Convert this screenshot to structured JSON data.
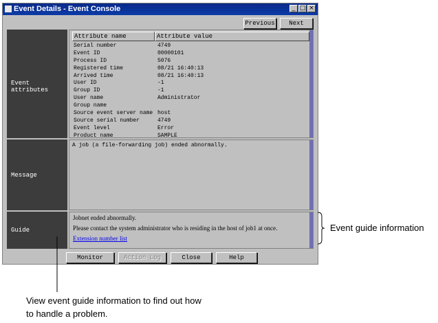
{
  "window": {
    "title": "Event Details - Event Console",
    "controls": [
      "_",
      "□",
      "×"
    ]
  },
  "nav": {
    "previous": "Previous",
    "next": "Next"
  },
  "sections": {
    "attributes": "Event attributes",
    "message": "Message",
    "guide": "Guide"
  },
  "table": {
    "headers": [
      "Attribute name",
      "Attribute value"
    ],
    "rows": [
      [
        "Serial number",
        "4749"
      ],
      [
        "Event ID",
        "00000101"
      ],
      [
        "Process ID",
        "5076"
      ],
      [
        "Registered time",
        "08/21 16:40:13"
      ],
      [
        "Arrived time",
        "08/21 16:40:13"
      ],
      [
        "User ID",
        "-1"
      ],
      [
        "Group ID",
        "-1"
      ],
      [
        "User name",
        "Administrator"
      ],
      [
        "Group name",
        ""
      ],
      [
        "Source event server name",
        "host"
      ],
      [
        "Source serial number",
        "4749"
      ],
      [
        "Event level",
        "Error"
      ],
      [
        "Product name",
        "SAMPLE"
      ]
    ]
  },
  "message": {
    "text": "A job (a file-forwarding job) ended abnormally."
  },
  "guide": {
    "line1": "Jobnet ended abnormally.",
    "line2": "Please contact the system administrator who is residing in the host of job1 at once.",
    "link": "Extension number list"
  },
  "buttons": {
    "monitor": "Monitor",
    "action_log": "Action Log",
    "close": "Close",
    "help": "Help"
  },
  "annotations": {
    "guide_info": "Event guide information",
    "view_line1": "View event guide information to find out how",
    "view_line2": "to handle a problem."
  }
}
